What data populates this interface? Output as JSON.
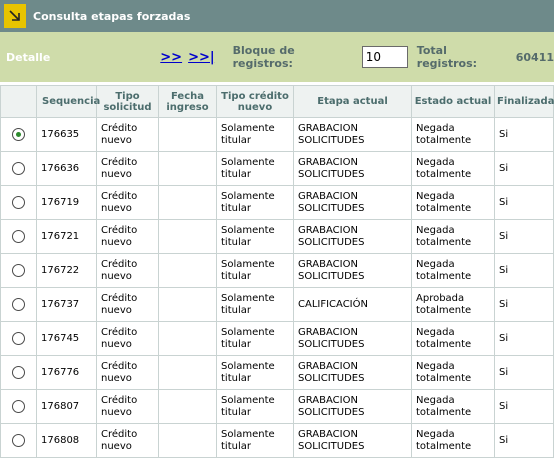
{
  "title": "Consulta etapas forzadas",
  "toolbar": {
    "detalle": "Detalle",
    "next": ">>",
    "last": ">>|",
    "block_label": "Bloque de registros:",
    "block_value": "10",
    "total_label": "Total registros:",
    "total_value": "60411"
  },
  "columns": [
    "Sequencia",
    "Tipo solicitud",
    "Fecha ingreso",
    "Tipo crédito nuevo",
    "Etapa actual",
    "Estado actual",
    "Finalizada"
  ],
  "rows": [
    {
      "selected": true,
      "seq": "176635",
      "tipo": "Crédito nuevo",
      "fecha": "",
      "tipo_credito": "Solamente titular",
      "etapa": "GRABACION SOLICITUDES",
      "estado": "Negada totalmente",
      "fin": "Si"
    },
    {
      "selected": false,
      "seq": "176636",
      "tipo": "Crédito nuevo",
      "fecha": "",
      "tipo_credito": "Solamente titular",
      "etapa": "GRABACION SOLICITUDES",
      "estado": "Negada totalmente",
      "fin": "Si"
    },
    {
      "selected": false,
      "seq": "176719",
      "tipo": "Crédito nuevo",
      "fecha": "",
      "tipo_credito": "Solamente titular",
      "etapa": "GRABACION SOLICITUDES",
      "estado": "Negada totalmente",
      "fin": "Si"
    },
    {
      "selected": false,
      "seq": "176721",
      "tipo": "Crédito nuevo",
      "fecha": "",
      "tipo_credito": "Solamente titular",
      "etapa": "GRABACION SOLICITUDES",
      "estado": "Negada totalmente",
      "fin": "Si"
    },
    {
      "selected": false,
      "seq": "176722",
      "tipo": "Crédito nuevo",
      "fecha": "",
      "tipo_credito": "Solamente titular",
      "etapa": "GRABACION SOLICITUDES",
      "estado": "Negada totalmente",
      "fin": "Si"
    },
    {
      "selected": false,
      "seq": "176737",
      "tipo": "Crédito nuevo",
      "fecha": "",
      "tipo_credito": "Solamente titular",
      "etapa": "CALIFICACIÓN",
      "estado": "Aprobada totalmente",
      "fin": "Si"
    },
    {
      "selected": false,
      "seq": "176745",
      "tipo": "Crédito nuevo",
      "fecha": "",
      "tipo_credito": "Solamente titular",
      "etapa": "GRABACION SOLICITUDES",
      "estado": "Negada totalmente",
      "fin": "Si"
    },
    {
      "selected": false,
      "seq": "176776",
      "tipo": "Crédito nuevo",
      "fecha": "",
      "tipo_credito": "Solamente titular",
      "etapa": "GRABACION SOLICITUDES",
      "estado": "Negada totalmente",
      "fin": "Si"
    },
    {
      "selected": false,
      "seq": "176807",
      "tipo": "Crédito nuevo",
      "fecha": "",
      "tipo_credito": "Solamente titular",
      "etapa": "GRABACION SOLICITUDES",
      "estado": "Negada totalmente",
      "fin": "Si"
    },
    {
      "selected": false,
      "seq": "176808",
      "tipo": "Crédito nuevo",
      "fecha": "",
      "tipo_credito": "Solamente titular",
      "etapa": "GRABACION SOLICITUDES",
      "estado": "Negada totalmente",
      "fin": "Si"
    }
  ]
}
